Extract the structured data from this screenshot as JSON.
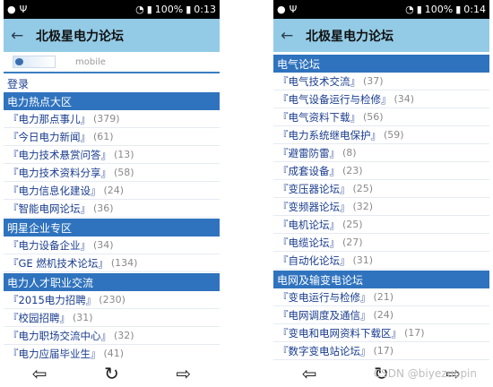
{
  "left_phone": {
    "status": {
      "battery": "100%",
      "time": "0:13"
    },
    "title": "北极星电力论坛",
    "logo_text": "北极星电力论坛",
    "logo_sub": "mobile",
    "login": "登录",
    "sections": [
      {
        "title": "电力热点大区",
        "items": [
          {
            "name": "『电力那点事儿』",
            "count": "(379)"
          },
          {
            "name": "『今日电力新闻』",
            "count": "(61)"
          },
          {
            "name": "『电力技术悬赏问答』",
            "count": "(13)"
          },
          {
            "name": "『电力技术资料分享』",
            "count": "(58)"
          },
          {
            "name": "『电力信息化建设』",
            "count": "(24)"
          },
          {
            "name": "『智能电网论坛』",
            "count": "(36)"
          }
        ]
      },
      {
        "title": "明星企业专区",
        "items": [
          {
            "name": "『电力设备企业』",
            "count": "(34)"
          },
          {
            "name": "『GE 燃机技术论坛』",
            "count": "(134)"
          }
        ]
      },
      {
        "title": "电力人才职业交流",
        "items": [
          {
            "name": "『2015电力招聘』",
            "count": "(230)"
          },
          {
            "name": "『校园招聘』",
            "count": "(31)"
          },
          {
            "name": "『电力职场交流中心』",
            "count": "(32)"
          },
          {
            "name": "『电力应届毕业生』",
            "count": "(41)"
          }
        ]
      }
    ]
  },
  "right_phone": {
    "status": {
      "battery": "100%",
      "time": "0:14"
    },
    "title": "北极星电力论坛",
    "sections": [
      {
        "title": "电气论坛",
        "items": [
          {
            "name": "『电气技术交流』",
            "count": "(37)"
          },
          {
            "name": "『电气设备运行与检修』",
            "count": "(34)"
          },
          {
            "name": "『电气资料下载』",
            "count": "(56)"
          },
          {
            "name": "『电力系统继电保护』",
            "count": "(59)"
          },
          {
            "name": "『避雷防雷』",
            "count": "(8)"
          },
          {
            "name": "『成套设备』",
            "count": "(23)"
          },
          {
            "name": "『变压器论坛』",
            "count": "(25)"
          },
          {
            "name": "『变频器论坛』",
            "count": "(32)"
          },
          {
            "name": "『电机论坛』",
            "count": "(25)"
          },
          {
            "name": "『电缆论坛』",
            "count": "(27)"
          },
          {
            "name": "『自动化论坛』",
            "count": "(31)"
          }
        ]
      },
      {
        "title": "电网及输变电论坛",
        "items": [
          {
            "name": "『变电运行与检修』",
            "count": "(21)"
          },
          {
            "name": "『电网调度及通信』",
            "count": "(24)"
          },
          {
            "name": "『变电和电网资料下载区』",
            "count": "(17)"
          },
          {
            "name": "『数字变电站论坛』",
            "count": "(17)"
          }
        ]
      }
    ]
  },
  "navbar": {
    "back_icon": "arrow-left-icon",
    "refresh_icon": "refresh-icon",
    "forward_icon": "arrow-right-icon"
  },
  "watermark": "CSDN @biyezuopin"
}
